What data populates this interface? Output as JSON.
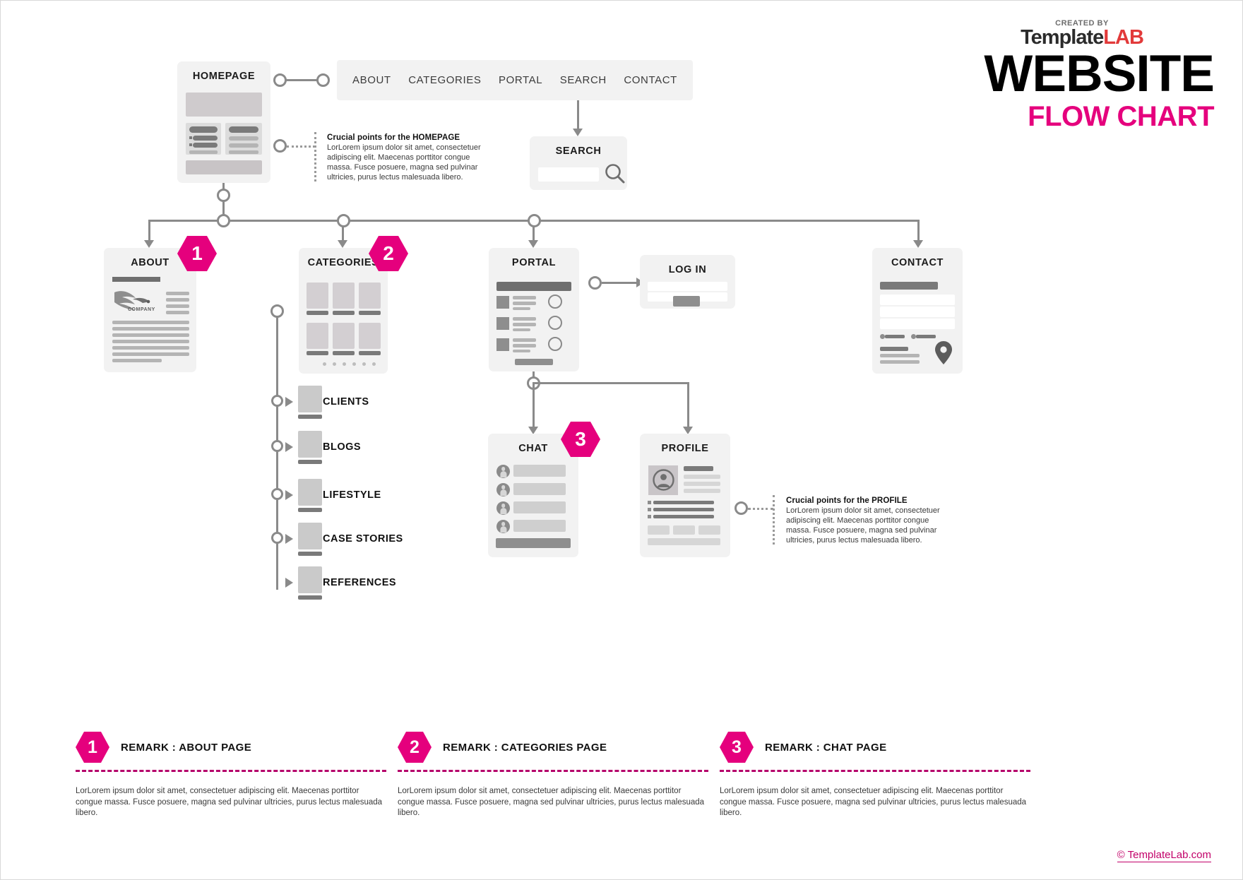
{
  "header": {
    "created_by": "CREATED BY",
    "brand_first": "Template",
    "brand_second": "LAB",
    "title": "WEBSITE",
    "subtitle": "FLOW CHART"
  },
  "navbar": {
    "items": [
      "ABOUT",
      "CATEGORIES",
      "PORTAL",
      "SEARCH",
      "CONTACT"
    ]
  },
  "nodes": {
    "homepage": "HOMEPAGE",
    "search": "SEARCH",
    "about": "ABOUT",
    "categories": "CATEGORIES",
    "portal": "PORTAL",
    "login": "LOG IN",
    "contact": "CONTACT",
    "chat": "CHAT",
    "profile": "PROFILE",
    "about_logo_text": "COMPANY"
  },
  "category_children": [
    "CLIENTS",
    "BLOGS",
    "LIFESTYLE",
    "CASE STORIES",
    "REFERENCES"
  ],
  "badges": {
    "about": "1",
    "categories": "2",
    "chat": "3"
  },
  "notes": [
    {
      "title": "Crucial points for the HOMEPAGE",
      "body": "LorLorem ipsum dolor sit amet, consectetuer adipiscing elit. Maecenas porttitor congue massa. Fusce posuere, magna sed pulvinar ultricies, purus lectus malesuada libero."
    },
    {
      "title": "Crucial points for the PROFILE",
      "body": "LorLorem ipsum dolor sit amet, consectetuer adipiscing elit. Maecenas porttitor congue massa. Fusce posuere, magna sed pulvinar ultricies, purus lectus malesuada libero."
    }
  ],
  "remarks": [
    {
      "number": "1",
      "title": "REMARK : ABOUT PAGE",
      "body": "LorLorem ipsum dolor sit amet, consectetuer adipiscing elit. Maecenas porttitor congue massa. Fusce posuere, magna sed pulvinar ultricies, purus lectus malesuada libero."
    },
    {
      "number": "2",
      "title": "REMARK : CATEGORIES PAGE",
      "body": "LorLorem ipsum dolor sit amet, consectetuer adipiscing elit. Maecenas porttitor congue massa. Fusce posuere, magna sed pulvinar ultricies, purus lectus malesuada libero."
    },
    {
      "number": "3",
      "title": "REMARK : CHAT PAGE",
      "body": "LorLorem ipsum dolor sit amet, consectetuer adipiscing elit. Maecenas porttitor congue massa. Fusce posuere, magna sed pulvinar ultricies, purus lectus malesuada libero."
    }
  ],
  "footer": {
    "copyright_mark": "©",
    "text": " TemplateLab.com"
  },
  "colors": {
    "accent": "#e5007d",
    "accent_dark": "#b5006a",
    "card_bg": "#f2f2f2",
    "line": "#8a8a8a",
    "logo_red": "#e23a3a"
  }
}
